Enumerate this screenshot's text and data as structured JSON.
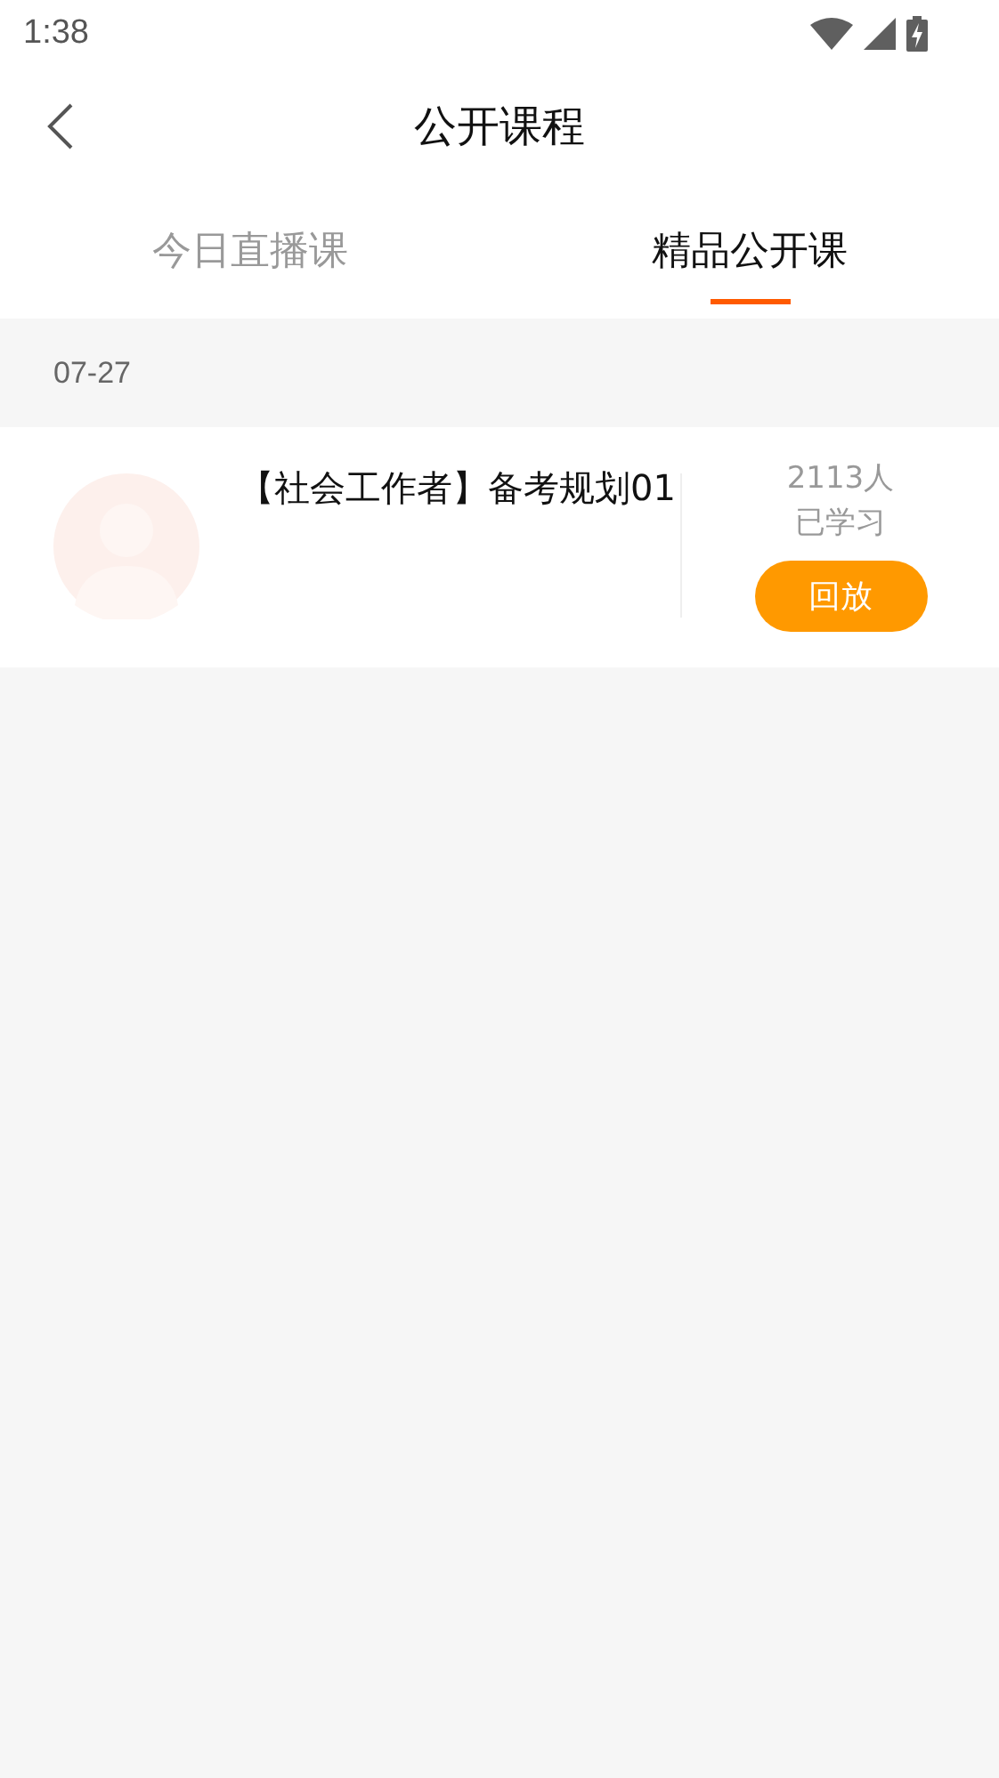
{
  "status_bar": {
    "time": "1:38"
  },
  "header": {
    "title": "公开课程"
  },
  "tabs": [
    {
      "label": "今日直播课",
      "selected": false
    },
    {
      "label": "精品公开课",
      "selected": true
    }
  ],
  "sections": [
    {
      "date": "07-27",
      "courses": [
        {
          "title": "【社会工作者】备考规划01",
          "learners": "2113人",
          "learners_label": "已学习",
          "action": "回放"
        }
      ]
    }
  ]
}
